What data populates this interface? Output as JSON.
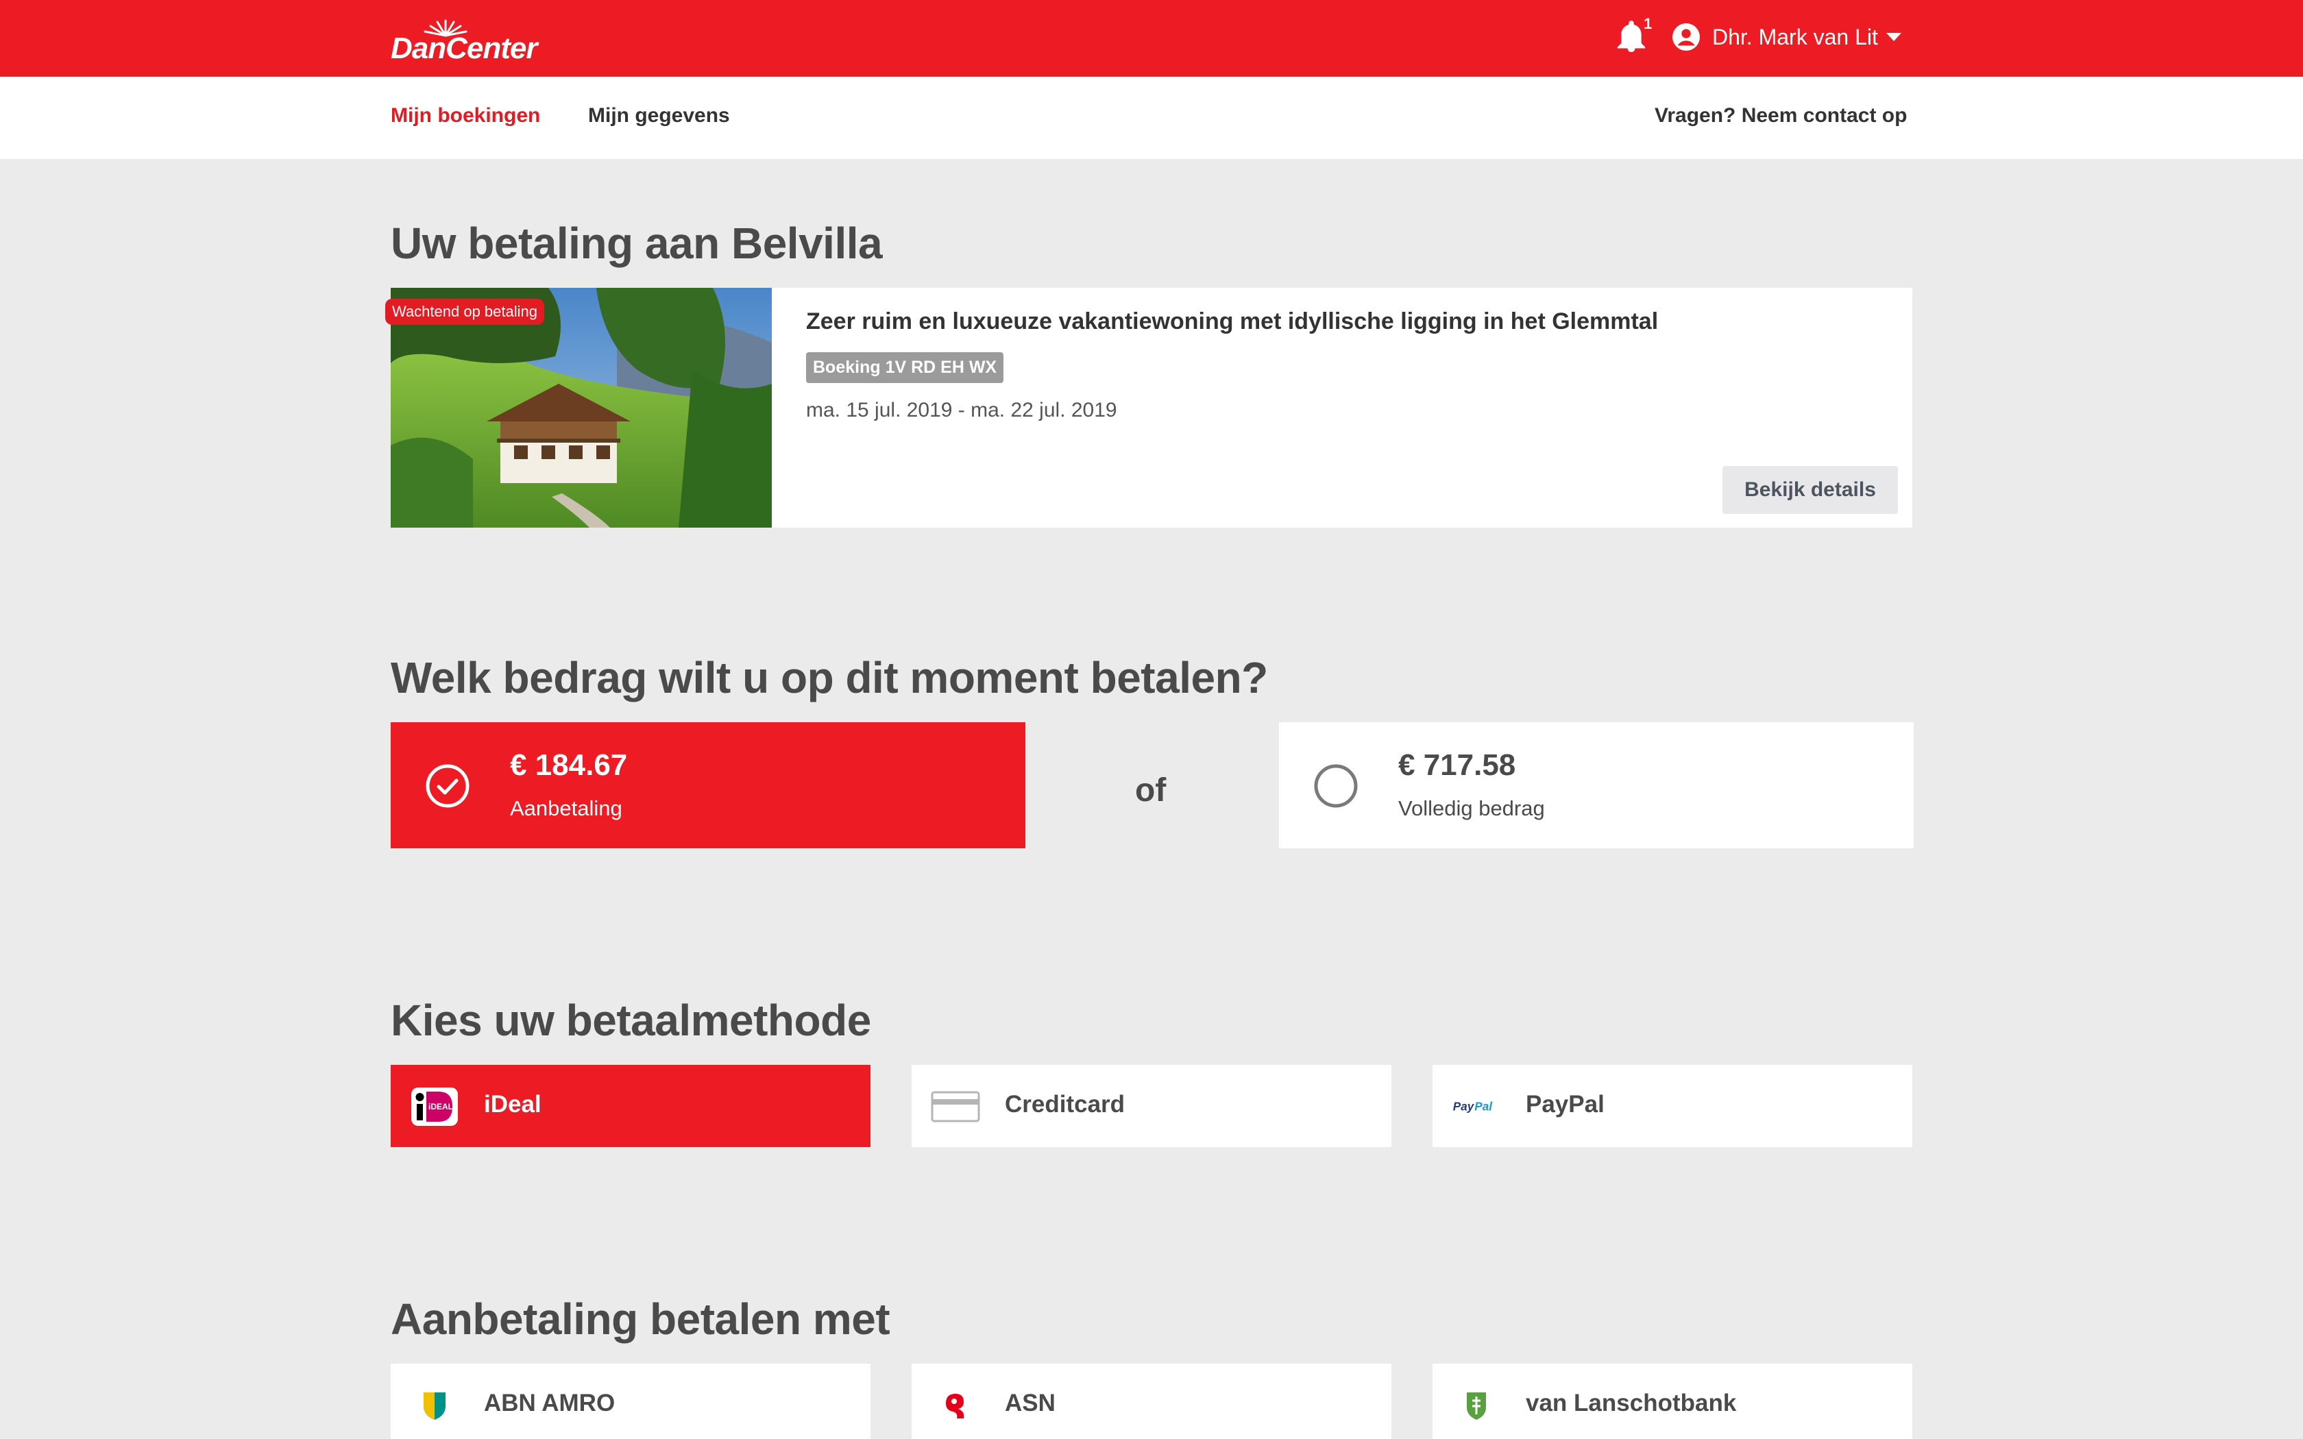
{
  "header": {
    "logo_text": "DanCenter",
    "notification_count": "1",
    "user_name": "Dhr. Mark van Lit",
    "brand_color": "#ed1c24"
  },
  "subnav": {
    "my_bookings": "Mijn boekingen",
    "my_details": "Mijn gegevens",
    "contact": "Vragen? Neem contact op"
  },
  "payment_heading": "Uw betaling aan Belvilla",
  "booking": {
    "status": "Wachtend op betaling",
    "title": "Zeer ruim en luxueuze vakantiewoning met idyllische ligging in het Glemmtal",
    "code": "Boeking 1V RD EH WX",
    "dates": "ma. 15 jul. 2019 - ma. 22 jul. 2019",
    "details_button": "Bekijk details"
  },
  "amount_heading": "Welk bedrag wilt u op dit moment betalen?",
  "amount_options": [
    {
      "value": "€ 184.67",
      "label": "Aanbetaling",
      "selected": true
    },
    {
      "value": "€ 717.58",
      "label": "Volledig bedrag",
      "selected": false
    }
  ],
  "or_text": "of",
  "method_heading": "Kies uw betaalmethode",
  "methods": [
    {
      "label": "iDeal",
      "icon": "ideal-icon",
      "selected": true
    },
    {
      "label": "Creditcard",
      "icon": "creditcard-icon",
      "selected": false
    },
    {
      "label": "PayPal",
      "icon": "paypal-icon",
      "selected": false
    }
  ],
  "bank_heading": "Aanbetaling betalen met",
  "banks": [
    {
      "label": "ABN AMRO",
      "icon": "abn-amro-icon"
    },
    {
      "label": "ASN",
      "icon": "asn-icon"
    },
    {
      "label": "van Lanschotbank",
      "icon": "van-lanschot-icon"
    }
  ]
}
